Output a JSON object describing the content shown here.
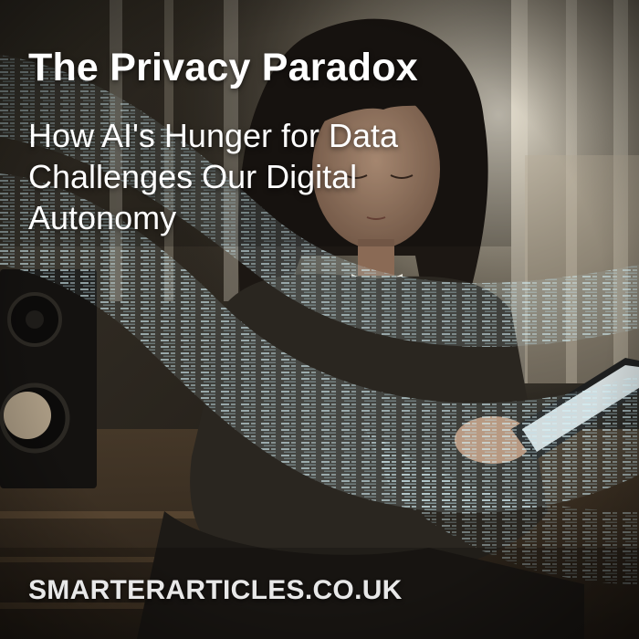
{
  "headline": {
    "title": "The Privacy Paradox",
    "subtitle": "How AI's Hunger for Data Challenges Our Digital Autonomy"
  },
  "footer": {
    "site": "SMARTERARTICLES.CO.UK"
  },
  "colors": {
    "text": "#ffffff",
    "footer_text": "#e8e8e8",
    "backdrop": "#1a1712",
    "window_light": "#d8d2c4",
    "data_stream": "#bfe3ee",
    "tablet_screen": "#e6eef0"
  },
  "icons": {
    "speaker": "speaker-icon",
    "tablet": "tablet-icon"
  }
}
